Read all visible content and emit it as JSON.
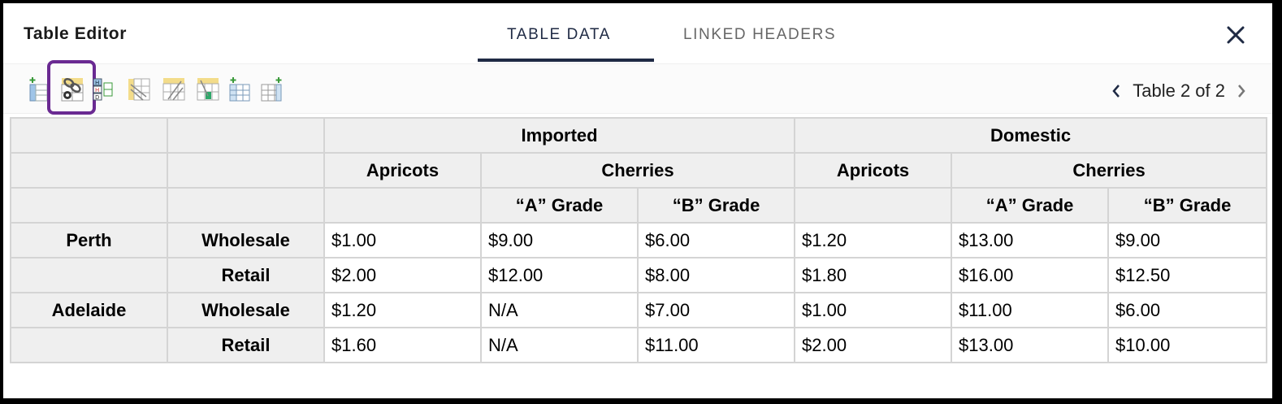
{
  "dialog": {
    "title": "Table Editor"
  },
  "tabs": [
    {
      "label": "TABLE DATA",
      "active": true
    },
    {
      "label": "LINKED HEADERS",
      "active": false
    }
  ],
  "toolbar": {
    "tools": [
      {
        "icon": "insert-column-icon"
      },
      {
        "icon": "link-settings-icon",
        "selected": true
      },
      {
        "icon": "header-legend-icon"
      },
      {
        "icon": "column-headers-icon"
      },
      {
        "icon": "row-headers-icon"
      },
      {
        "icon": "cell-headers-icon"
      },
      {
        "icon": "add-row-icon"
      },
      {
        "icon": "add-column-icon"
      }
    ]
  },
  "pager": {
    "label": "Table 2 of 2"
  },
  "table": {
    "col_groups": [
      "Imported",
      "Domestic"
    ],
    "subgroups": [
      "Apricots",
      "Cherries",
      "Apricots",
      "Cherries"
    ],
    "grades": [
      "“A” Grade",
      "“B” Grade",
      "“A” Grade",
      "“B” Grade"
    ],
    "rows": [
      {
        "city": "Perth",
        "type": "Wholesale",
        "values": [
          "$1.00",
          "$9.00",
          "$6.00",
          "$1.20",
          "$13.00",
          "$9.00"
        ]
      },
      {
        "city": "",
        "type": "Retail",
        "values": [
          "$2.00",
          "$12.00",
          "$8.00",
          "$1.80",
          "$16.00",
          "$12.50"
        ]
      },
      {
        "city": "Adelaide",
        "type": "Wholesale",
        "values": [
          "$1.20",
          "N/A",
          "$7.00",
          "$1.00",
          "$11.00",
          "$6.00"
        ]
      },
      {
        "city": "",
        "type": "Retail",
        "values": [
          "$1.60",
          "N/A",
          "$11.00",
          "$2.00",
          "$13.00",
          "$10.00"
        ]
      }
    ]
  },
  "colors": {
    "accent": "#1f2a44",
    "selection": "#6a2a92",
    "header_bg": "#efefef",
    "border": "#d4d4d4"
  }
}
